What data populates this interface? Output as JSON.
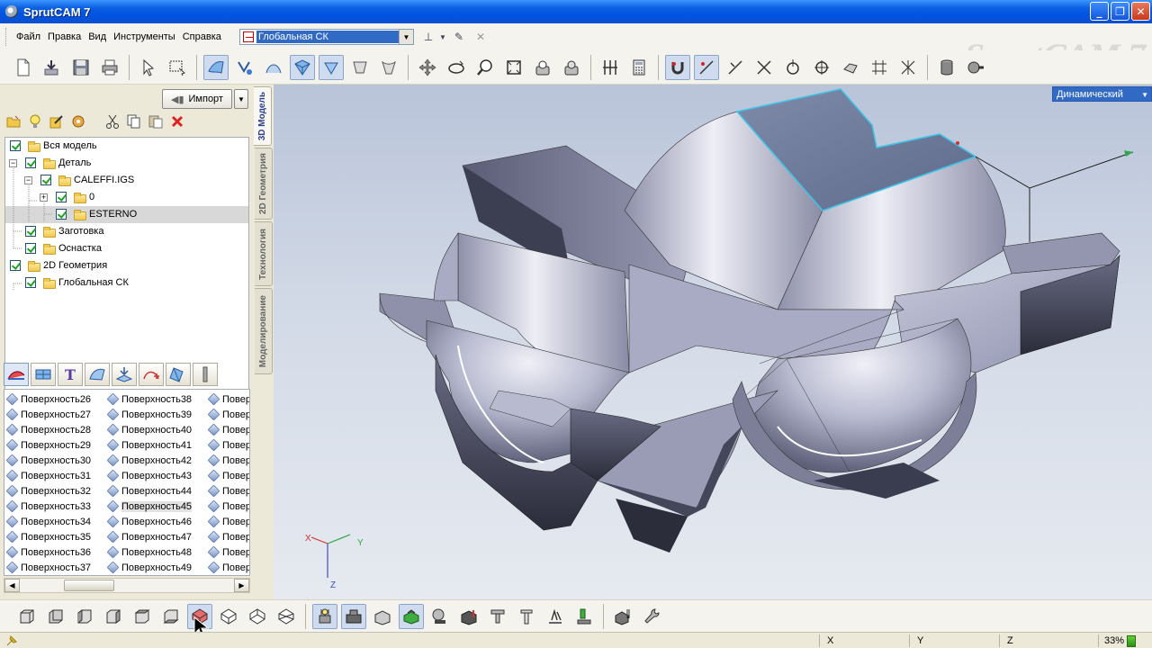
{
  "window": {
    "title": "SprutCAM 7"
  },
  "menu": [
    {
      "label": "Файл"
    },
    {
      "label": "Правка"
    },
    {
      "label": "Вид"
    },
    {
      "label": "Инструменты"
    },
    {
      "label": "Справка"
    }
  ],
  "coord_system": {
    "selected": "Глобальная СК"
  },
  "logo": "SprutCAM 7",
  "left_panel": {
    "import_label": "Импорт",
    "tree": [
      {
        "label": "Вся модель",
        "level": 0
      },
      {
        "label": "Деталь",
        "level": 1
      },
      {
        "label": "CALEFFI.IGS",
        "level": 2
      },
      {
        "label": "0",
        "level": 3
      },
      {
        "label": "ESTERNO",
        "level": 3,
        "selected": true
      },
      {
        "label": "Заготовка",
        "level": 1
      },
      {
        "label": "Оснастка",
        "level": 1
      },
      {
        "label": "2D Геометрия",
        "level": 0
      },
      {
        "label": "Глобальная СК",
        "level": 1
      }
    ],
    "surfaces": {
      "col1": [
        "Поверхность26",
        "Поверхность27",
        "Поверхность28",
        "Поверхность29",
        "Поверхность30",
        "Поверхность31",
        "Поверхность32",
        "Поверхность33",
        "Поверхность34",
        "Поверхность35",
        "Поверхность36",
        "Поверхность37"
      ],
      "col2": [
        "Поверхность38",
        "Поверхность39",
        "Поверхность40",
        "Поверхность41",
        "Поверхность42",
        "Поверхность43",
        "Поверхность44",
        "Поверхность45",
        "Поверхность46",
        "Поверхность47",
        "Поверхность48",
        "Поверхность49"
      ],
      "col3": [
        "Повер",
        "Повер",
        "Повер",
        "Повер",
        "Повер",
        "Повер",
        "Повер",
        "Повер",
        "Повер",
        "Повер",
        "Повер",
        "Повер"
      ],
      "selected": "Поверхность45"
    }
  },
  "vertical_tabs": [
    {
      "label": "3D Модель",
      "active": true
    },
    {
      "label": "2D Геометрия",
      "active": false
    },
    {
      "label": "Технология",
      "active": false
    },
    {
      "label": "Моделирование",
      "active": false
    }
  ],
  "viewport": {
    "view_mode": "Динамический",
    "axis_labels": {
      "x": "X",
      "y": "Y",
      "z": "Z"
    }
  },
  "status": {
    "x_label": "X",
    "y_label": "Y",
    "z_label": "Z",
    "progress": "33%"
  },
  "colors": {
    "title_bar": "#0054e3",
    "model_face": "#a9abc4",
    "model_highlight_edge": "#3fc3e6",
    "selection": "#316ac5"
  }
}
